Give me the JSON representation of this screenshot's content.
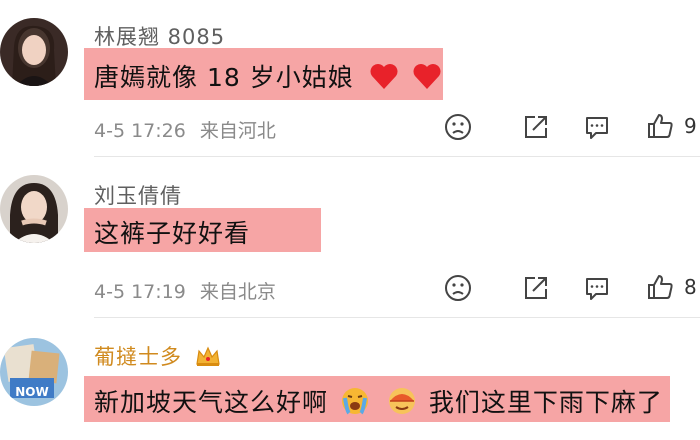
{
  "comments": [
    {
      "username": "林展翘 8085",
      "text": "唐嫣就像 18 岁小姑娘",
      "emojis": [
        "heart",
        "heart"
      ],
      "time": "4-5 17:26",
      "location": "来自河北",
      "like_count": "9"
    },
    {
      "username": "刘玉倩倩",
      "text": "这裤子好好看",
      "time": "4-5 17:19",
      "location": "来自北京",
      "like_count": "8"
    },
    {
      "username": "葡撻士多",
      "badge": "crown",
      "text_a": "新加坡天气这么好啊",
      "text_b": "我们这里下雨下麻了",
      "emojis": [
        "crying-face",
        "umbrella-face"
      ]
    }
  ],
  "avatar_texts": {
    "third": "NOW"
  },
  "colors": {
    "highlight": "#f6a5a5",
    "username": "#5f5f5f",
    "username_gold": "#d08a1e",
    "meta": "#8a8a8a",
    "heart": "#e8222a"
  },
  "icons": [
    "face-icon",
    "share-icon",
    "comment-icon",
    "like-icon"
  ]
}
